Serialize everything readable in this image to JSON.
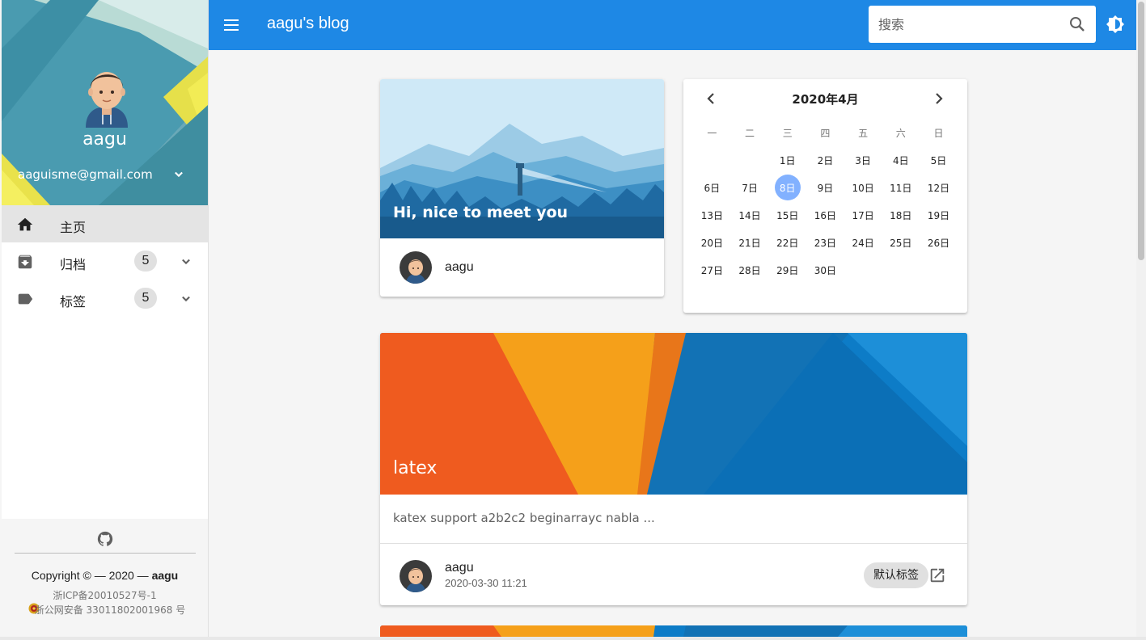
{
  "app": {
    "title": "aagu's blog"
  },
  "search": {
    "placeholder": "搜索"
  },
  "user": {
    "name": "aagu",
    "email": "aaguisme@gmail.com"
  },
  "nav": [
    {
      "label": "主页",
      "icon": "home-icon",
      "active": true
    },
    {
      "label": "归档",
      "icon": "archive-icon",
      "count": "5"
    },
    {
      "label": "标签",
      "icon": "label-icon",
      "count": "5"
    }
  ],
  "footer": {
    "copyright_prefix": "Copyright © — 2020 —",
    "copyright_owner": "aagu",
    "icp": "浙ICP备20010527号-1",
    "gongan": "浙公网安备 33011802001968 号"
  },
  "hi_card": {
    "text": "Hi, nice to meet you",
    "author": "aagu"
  },
  "calendar": {
    "title": "2020年4月",
    "weekdays": [
      "一",
      "二",
      "三",
      "四",
      "五",
      "六",
      "日"
    ],
    "days": [
      "",
      "",
      "1日",
      "2日",
      "3日",
      "4日",
      "5日",
      "6日",
      "7日",
      "8日",
      "9日",
      "10日",
      "11日",
      "12日",
      "13日",
      "14日",
      "15日",
      "16日",
      "17日",
      "18日",
      "19日",
      "20日",
      "21日",
      "22日",
      "23日",
      "24日",
      "25日",
      "26日",
      "27日",
      "28日",
      "29日",
      "30日",
      "",
      "",
      ""
    ],
    "today": "8日"
  },
  "post": {
    "title": "latex",
    "excerpt": "katex support a2b2c2 beginarrayc nabla ...",
    "author": "aagu",
    "date": "2020-03-30 11:21",
    "tag": "默认标签"
  },
  "colors": {
    "primary": "#1e88e5",
    "today": "#82b1ff"
  }
}
